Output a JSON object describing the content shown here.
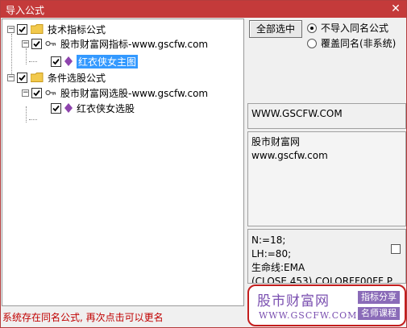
{
  "window": {
    "title": "导入公式",
    "close_glyph": "✕"
  },
  "tree": [
    {
      "label": "技术指标公式",
      "expander": "−"
    },
    {
      "label": "股市财富网指标-www.gscfw.com",
      "expander": "−"
    },
    {
      "label": "红衣侠女主图"
    },
    {
      "label": "条件选股公式",
      "expander": "−"
    },
    {
      "label": "股市财富网选股-www.gscfw.com",
      "expander": "−"
    },
    {
      "label": "红衣侠女选股"
    }
  ],
  "buttons": {
    "select_all": "全部选中"
  },
  "options": [
    {
      "label": "不导入同名公式",
      "checked": true
    },
    {
      "label": "覆盖同名(非系统)",
      "checked": false
    }
  ],
  "info": {
    "website": "WWW.GSCFW.COM",
    "desc_line1": "股市财富网",
    "desc_line2": "www.gscfw.com",
    "code_line1": "N:=18;",
    "code_line2": "LH:=80;",
    "code_line3": "生命线:EMA",
    "code_line4": "(CLOSE,453),COLORFF00FF,P"
  },
  "status": "系统存在同名公式, 再次点击可以更名",
  "watermark": {
    "name": "股市财富网",
    "url": "WWW.GSCFW.COM",
    "tag1": "指标分享",
    "tag2": "名师课程"
  },
  "colors": {
    "title_bar": "#c43a3a",
    "selection": "#3399ff",
    "status_text": "#c00000",
    "logo_purple": "#7a4fb0"
  }
}
